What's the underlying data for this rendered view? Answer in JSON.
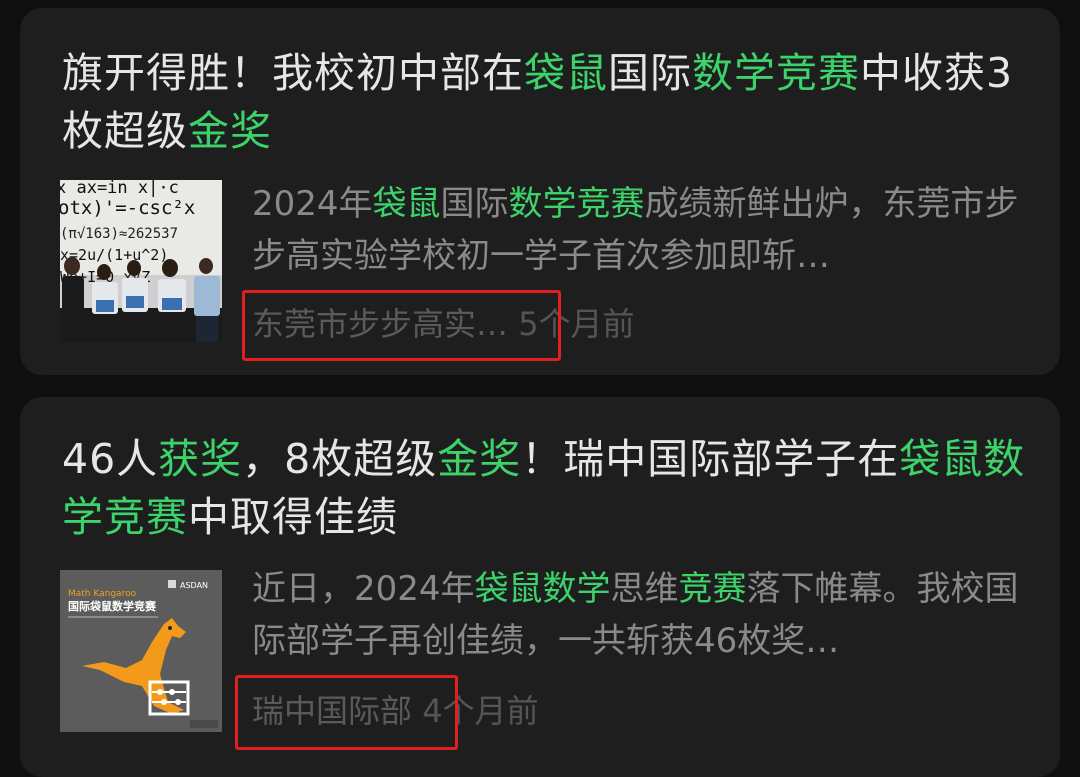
{
  "articles": [
    {
      "title_parts": [
        {
          "t": "旗开得胜！我校初中部在",
          "hl": false
        },
        {
          "t": "袋鼠",
          "hl": true
        },
        {
          "t": "国际",
          "hl": false
        },
        {
          "t": "数学竞赛",
          "hl": true
        },
        {
          "t": "中收获3枚超级",
          "hl": false
        },
        {
          "t": "金奖",
          "hl": true
        }
      ],
      "snippet_parts": [
        {
          "t": "2024年",
          "hl": false
        },
        {
          "t": "袋鼠",
          "hl": true
        },
        {
          "t": "国际",
          "hl": false
        },
        {
          "t": "数学竞赛",
          "hl": true
        },
        {
          "t": "成绩新鲜出炉，东莞市步步高实验学校初一学子首次参加即斩…",
          "hl": false
        }
      ],
      "source": "东莞市步步高实…",
      "time": "5个月前",
      "thumb_text": {
        "l1": "x ax=in  x|·c",
        "l2": "otx)'=-csc²x",
        "l3": "(π√163)≈262537",
        "l4": "x=2u/(1+u^2)",
        "l5": "We+I=0  x√Z"
      }
    },
    {
      "title_parts": [
        {
          "t": "46人",
          "hl": false
        },
        {
          "t": "获奖",
          "hl": true
        },
        {
          "t": "，8枚超级",
          "hl": false
        },
        {
          "t": "金奖",
          "hl": true
        },
        {
          "t": "！瑞中国际部学子在",
          "hl": false
        },
        {
          "t": "袋鼠数学竞赛",
          "hl": true
        },
        {
          "t": "中取得佳绩",
          "hl": false
        }
      ],
      "snippet_parts": [
        {
          "t": "近日，2024年",
          "hl": false
        },
        {
          "t": "袋鼠数学",
          "hl": true
        },
        {
          "t": "思维",
          "hl": false
        },
        {
          "t": "竞赛",
          "hl": true
        },
        {
          "t": "落下帷幕。我校国际部学子再创佳绩，一共斩获46枚奖…",
          "hl": false
        }
      ],
      "source": "瑞中国际部",
      "time": "4个月前",
      "thumb_text": {
        "brand_en": "Math Kangaroo",
        "brand_cn": "国际袋鼠数学竞赛",
        "logo_text": "ASDAN"
      }
    }
  ],
  "colors": {
    "highlight": "#3dd36b",
    "annotation_box": "#e02020"
  }
}
